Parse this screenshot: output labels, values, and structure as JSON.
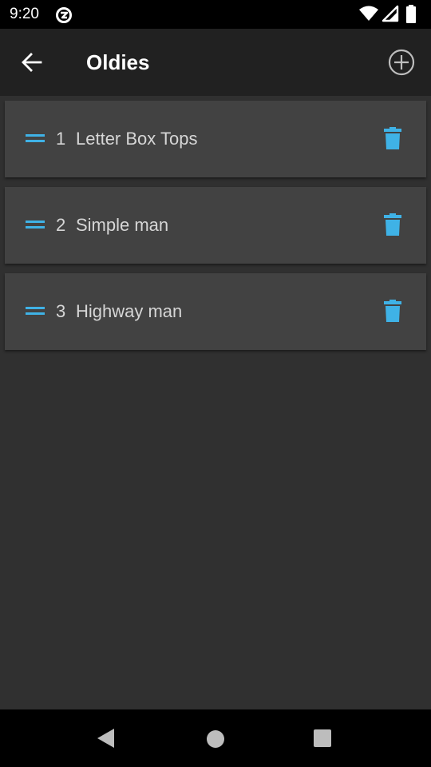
{
  "status_bar": {
    "time": "9:20",
    "icons": [
      "data-saver-icon",
      "wifi-icon",
      "signal-icon",
      "battery-icon"
    ]
  },
  "app_bar": {
    "title": "Oldies",
    "back_icon": "arrow-left-icon",
    "add_icon": "add-circle-icon"
  },
  "playlist": {
    "items": [
      {
        "number": "1",
        "title": "Letter Box Tops"
      },
      {
        "number": "2",
        "title": "Simple man"
      },
      {
        "number": "3",
        "title": "Highway man"
      }
    ],
    "item_icons": {
      "drag": "drag-handle-icon",
      "delete": "trash-icon"
    }
  },
  "nav_bar": {
    "icons": [
      "back-triangle-icon",
      "home-circle-icon",
      "recents-square-icon"
    ]
  },
  "colors": {
    "background": "#303030",
    "app_bar": "#212121",
    "card": "#424242",
    "accent": "#3fb2e6",
    "text": "#d6d6d6"
  }
}
